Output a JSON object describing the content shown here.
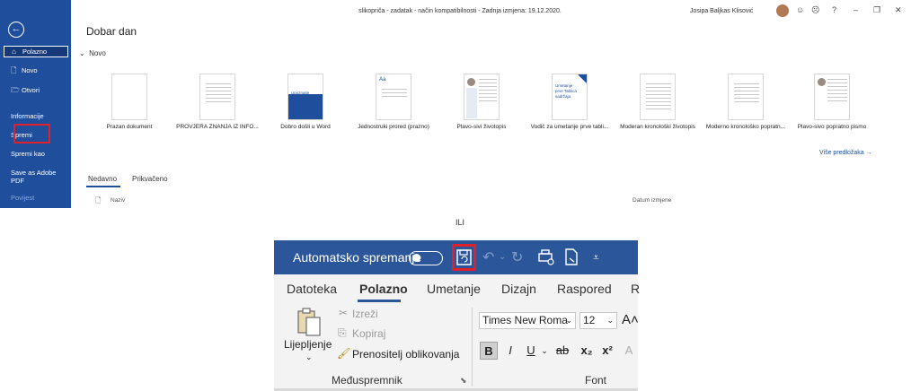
{
  "top": {
    "title": "slikopriča - zadatak  -  način kompatibilnosti  -  Zadnja izmjena: 19.12.2020.",
    "greeting": "Dobar dan",
    "user": "Josipa Baljkas Klisović",
    "window_buttons": [
      "☺",
      "☹",
      "?",
      "–",
      "❐",
      "✕"
    ],
    "sidebar": {
      "back": "←",
      "items": [
        {
          "label": "Polazno",
          "icon": "⌂"
        },
        {
          "label": "Novo",
          "icon": "🗋"
        },
        {
          "label": "Otvori",
          "icon": "🗁"
        },
        {
          "label": "Informacije"
        },
        {
          "label": "Spremi"
        },
        {
          "label": "Spremi kao"
        },
        {
          "label": "Save as Adobe PDF"
        },
        {
          "label": "Povijest"
        }
      ]
    },
    "new_section": "Novo",
    "templates": [
      {
        "name": "Prazan dokument",
        "thumb": ""
      },
      {
        "name": "PROVJERA ZNANJA IZ INFO...",
        "thumb": ""
      },
      {
        "name": "Dobro došli u Word",
        "thumb": "Upoznajte sustav"
      },
      {
        "name": "Jednostruki prored (prazno)",
        "thumb": "Aa"
      },
      {
        "name": "Plavo-sivi životopis",
        "thumb": ""
      },
      {
        "name": "Vodič za umetanje prve tabli...",
        "thumb": "Umetanje prve Tablica sadržaja"
      },
      {
        "name": "Moderan kronološki životopis",
        "thumb": ""
      },
      {
        "name": "Moderno kronološko popratn...",
        "thumb": ""
      },
      {
        "name": "Plavo-sivo popratno pismo",
        "thumb": ""
      }
    ],
    "more_templates": "Više predložaka  →",
    "tabs": [
      "Nedavno",
      "Prikvačeno"
    ],
    "header_name": "Naziv",
    "header_date": "Datum izmjene"
  },
  "separator": "ILI",
  "ribbon": {
    "autosave_label": "Automatsko spremanje",
    "tabs": [
      "Datoteka",
      "Polazno",
      "Umetanje",
      "Dizajn",
      "Raspored",
      "R"
    ],
    "clipboard": {
      "paste": "Lijepljenje",
      "cut": "Izreži",
      "copy": "Kopiraj",
      "format_painter": "Prenositelj oblikovanja",
      "group_label": "Međuspremnik"
    },
    "font": {
      "family": "Times New Roma",
      "size": "12",
      "group_label": "Font",
      "buttons": [
        "B",
        "I",
        "U",
        "ab",
        "x₂",
        "x²"
      ]
    }
  },
  "colors": {
    "sidebar_blue": "#1e4e9c",
    "ribbon_blue": "#2b579a",
    "highlight_red": "#e0202b"
  }
}
